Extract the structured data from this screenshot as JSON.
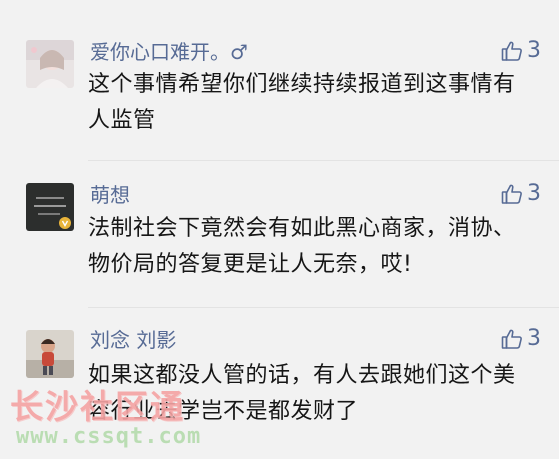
{
  "comments": [
    {
      "username": "爱你心口难开。♂",
      "like_count": "3",
      "content": "这个事情希望你们继续持续报道到这事情有人监管"
    },
    {
      "username": "萌想",
      "like_count": "3",
      "content": "法制社会下竟然会有如此黑心商家，消协、物价局的答复更是让人无奈，哎!"
    },
    {
      "username": "刘念 刘影",
      "like_count": "3",
      "content": "如果这都没人管的话，有人去跟她们这个美容行业去学岂不是都发财了"
    }
  ],
  "watermark": {
    "site_name": "长沙社区通",
    "url": "www.cssqt.com"
  },
  "colors": {
    "background": "#f2f2f2",
    "username": "#576b95",
    "content_text": "#161616",
    "watermark_text": "#f5a3a3",
    "watermark_url": "#b8dcb0"
  },
  "icons": {
    "like": "thumbs-up-icon"
  }
}
